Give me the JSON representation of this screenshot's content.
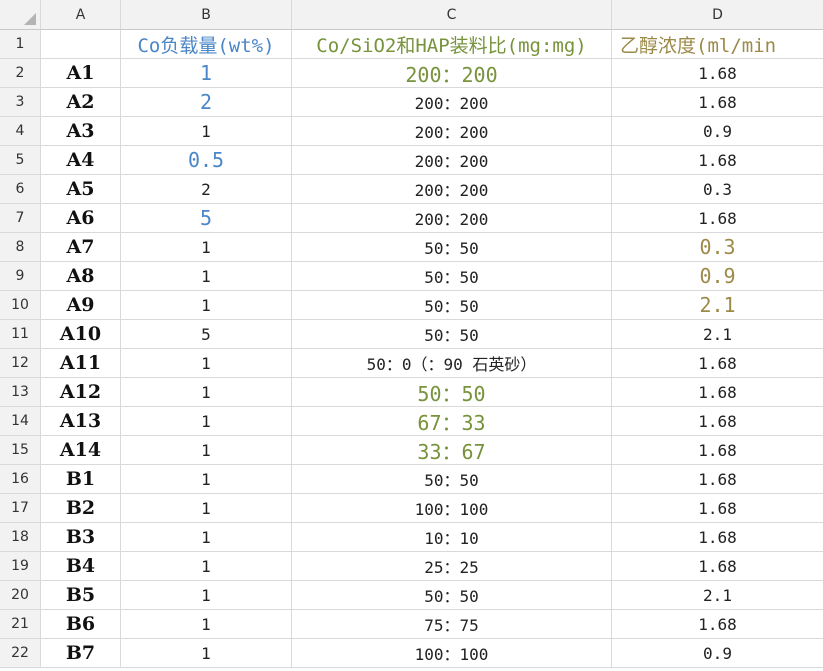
{
  "columns": [
    "A",
    "B",
    "C",
    "D"
  ],
  "header": {
    "b": "Co负载量(wt%)",
    "c": "Co/SiO2和HAP装料比(mg:mg)",
    "d": "乙醇浓度(ml/min"
  },
  "colors": {
    "blue": "#4a86c8",
    "green": "#77933c",
    "olive": "#9c8a49",
    "grid": "#d9d9d9"
  },
  "rows": [
    {
      "num": "2",
      "a": "A1",
      "b": "1",
      "c": "200：200",
      "d": "1.68"
    },
    {
      "num": "3",
      "a": "A2",
      "b": "2",
      "c": "200：200",
      "d": "1.68"
    },
    {
      "num": "4",
      "a": "A3",
      "b": "1",
      "c": "200：200",
      "d": "0.9"
    },
    {
      "num": "5",
      "a": "A4",
      "b": "0.5",
      "c": "200：200",
      "d": "1.68"
    },
    {
      "num": "6",
      "a": "A5",
      "b": "2",
      "c": "200：200",
      "d": "0.3"
    },
    {
      "num": "7",
      "a": "A6",
      "b": "5",
      "c": "200：200",
      "d": "1.68"
    },
    {
      "num": "8",
      "a": "A7",
      "b": "1",
      "c": "50：50",
      "d": "0.3"
    },
    {
      "num": "9",
      "a": "A8",
      "b": "1",
      "c": "50：50",
      "d": "0.9"
    },
    {
      "num": "10",
      "a": "A9",
      "b": "1",
      "c": "50：50",
      "d": "2.1"
    },
    {
      "num": "11",
      "a": "A10",
      "b": "5",
      "c": "50：50",
      "d": "2.1"
    },
    {
      "num": "12",
      "a": "A11",
      "b": "1",
      "c": "50：0（：90 石英砂）",
      "d": "1.68"
    },
    {
      "num": "13",
      "a": "A12",
      "b": "1",
      "c": "50：50",
      "d": "1.68"
    },
    {
      "num": "14",
      "a": "A13",
      "b": "1",
      "c": "67：33",
      "d": "1.68"
    },
    {
      "num": "15",
      "a": "A14",
      "b": "1",
      "c": "33：67",
      "d": "1.68"
    },
    {
      "num": "16",
      "a": "B1",
      "b": "1",
      "c": "50：50",
      "d": "1.68"
    },
    {
      "num": "17",
      "a": "B2",
      "b": "1",
      "c": "100：100",
      "d": "1.68"
    },
    {
      "num": "18",
      "a": "B3",
      "b": "1",
      "c": "10：10",
      "d": "1.68"
    },
    {
      "num": "19",
      "a": "B4",
      "b": "1",
      "c": "25：25",
      "d": "1.68"
    },
    {
      "num": "20",
      "a": "B5",
      "b": "1",
      "c": "50：50",
      "d": "2.1"
    },
    {
      "num": "21",
      "a": "B6",
      "b": "1",
      "c": "75：75",
      "d": "1.68"
    },
    {
      "num": "22",
      "a": "B7",
      "b": "1",
      "c": "100：100",
      "d": "0.9"
    }
  ],
  "row1_num": "1"
}
